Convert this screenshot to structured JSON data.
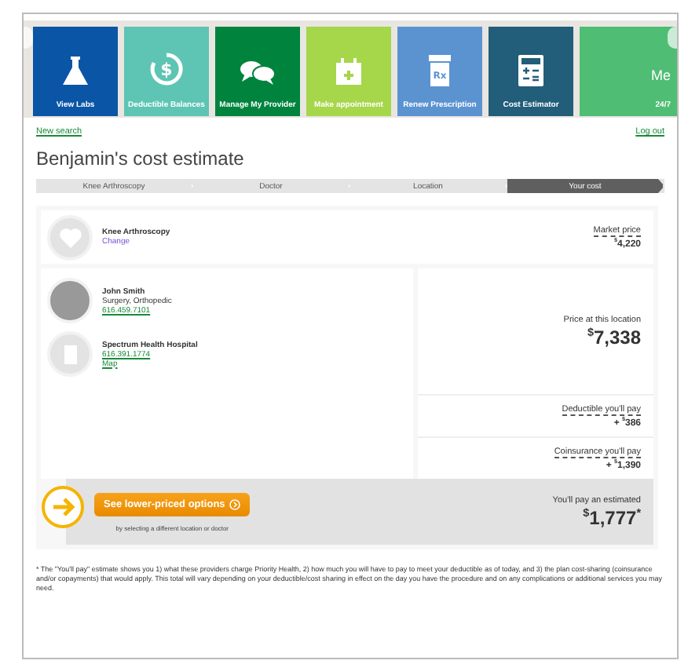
{
  "tiles": [
    {
      "kind": "flask",
      "label": "View Labs",
      "color": "#0b55a6"
    },
    {
      "kind": "dollar",
      "glyph": "$",
      "label": "Deductible Balances",
      "color": "#5ec4b4"
    },
    {
      "kind": "chat",
      "label": "Manage My Provider",
      "color": "#00843d"
    },
    {
      "kind": "calendar",
      "label": "Make appointment",
      "color": "#a6d64a"
    },
    {
      "kind": "rx",
      "glyph": "Rx",
      "label": "Renew Prescription",
      "color": "#5b93d1"
    },
    {
      "kind": "calculator",
      "label": "Cost Estimator",
      "color": "#225d7a"
    },
    {
      "kind": "text",
      "title": "Me",
      "label": "24/7",
      "color": "#4fbd73"
    }
  ],
  "links": {
    "new_search": "New search",
    "log_out": "Log out"
  },
  "title": "Benjamin's cost estimate",
  "steps": [
    {
      "label": "Knee Arthroscopy",
      "selected": false
    },
    {
      "label": "Doctor",
      "selected": false
    },
    {
      "label": "Location",
      "selected": false
    },
    {
      "label": "Your cost",
      "selected": true
    }
  ],
  "procedure": {
    "name": "Knee Arthroscopy",
    "change": "Change",
    "market": {
      "label": "Market price",
      "currency": "$",
      "amount": "4,220"
    }
  },
  "doctor": {
    "name": "John Smith",
    "specialty": "Surgery, Orthopedic",
    "phone": "616.459.7101"
  },
  "location": {
    "name": "Spectrum Health Hospital",
    "phone": "616.391.1774",
    "map": "Map"
  },
  "price": {
    "label": "Price at this location",
    "currency": "$",
    "amount": "7,338"
  },
  "charges": [
    {
      "label": "Deductible you'll pay",
      "sign": "+",
      "currency": "$",
      "amount": "386"
    },
    {
      "label": "Coinsurance you'll pay",
      "sign": "+",
      "currency": "$",
      "amount": "1,390"
    }
  ],
  "cta": {
    "button": "See lower-priced options",
    "sub": "by selecting a different location or doctor"
  },
  "total": {
    "label": "You'll pay an estimated",
    "currency": "$",
    "amount": "1,777",
    "suffix": "*"
  },
  "footnote": "* The \"You'll pay\" estimate shows you 1) what these providers charge Priority Health, 2) how much you will have to pay to meet your deductible as of today, and 3) the plan cost-sharing (coinsurance and/or copayments) that would apply. This total will vary depending on your deductible/cost sharing in effect on the day you have the procedure and on any complications or additional services you may need."
}
